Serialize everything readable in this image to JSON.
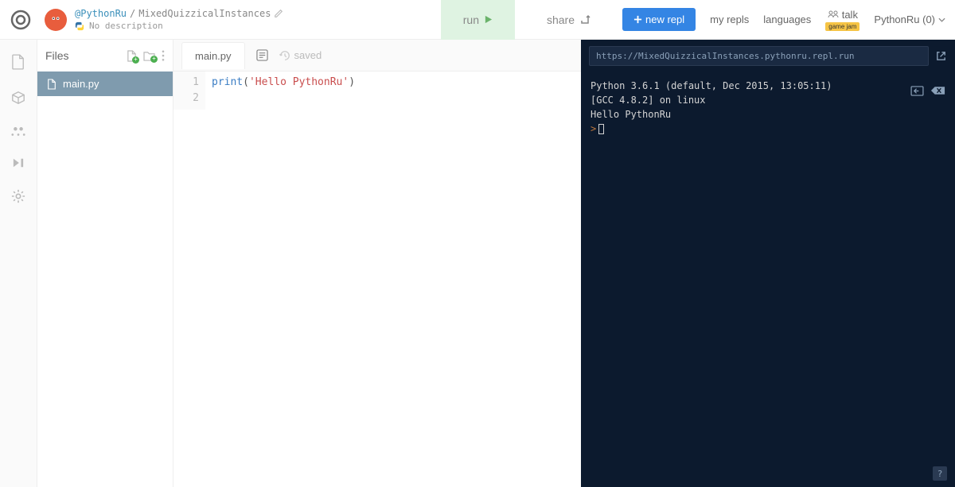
{
  "header": {
    "user": "@PythonRu",
    "separator": "/",
    "project": "MixedQuizzicalInstances",
    "description": "No description",
    "run_label": "run",
    "share_label": "share",
    "new_repl_label": "new repl",
    "nav": {
      "my_repls": "my repls",
      "languages": "languages",
      "talk": "talk",
      "talk_badge": "game jam"
    },
    "user_menu": "PythonRu (0)"
  },
  "sidebar": {
    "title": "Files",
    "items": [
      {
        "name": "main.py"
      }
    ]
  },
  "editor": {
    "tab": "main.py",
    "saved_label": "saved",
    "lines": [
      "1",
      "2"
    ],
    "code": {
      "fn": "print",
      "paren_open": "(",
      "str": "'Hello PythonRu'",
      "paren_close": ")"
    }
  },
  "terminal": {
    "url": "https://MixedQuizzicalInstances.pythonru.repl.run",
    "line1": "Python 3.6.1 (default, Dec 2015, 13:05:11)",
    "line2": "[GCC 4.8.2] on linux",
    "line3": "Hello PythonRu",
    "prompt": ">",
    "help": "?"
  }
}
